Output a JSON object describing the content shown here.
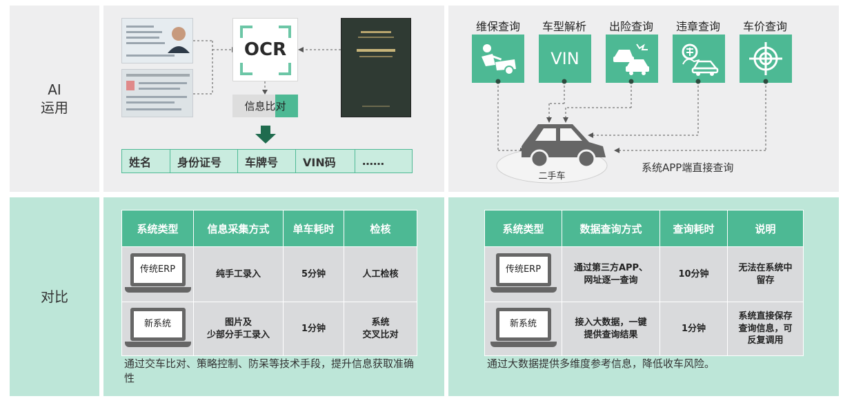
{
  "rows": {
    "ai": "AI\n运用",
    "compare": "对比"
  },
  "ocr": {
    "label": "OCR",
    "compare_label": "信息比对",
    "fields": [
      "姓名",
      "身份证号",
      "车牌号",
      "VIN码",
      "……"
    ]
  },
  "services": {
    "items": [
      {
        "label": "维保查询",
        "icon": "repair-icon"
      },
      {
        "label": "车型解析",
        "icon": "vin-icon",
        "tile_text": "VIN"
      },
      {
        "label": "出险查询",
        "icon": "accident-icon"
      },
      {
        "label": "违章查询",
        "icon": "violation-icon"
      },
      {
        "label": "车价查询",
        "icon": "target-icon"
      }
    ],
    "car_caption": "二手车",
    "direct_note": "系统APP端直接查询"
  },
  "left_table": {
    "headers": [
      "系统类型",
      "信息采集方式",
      "单车耗时",
      "检核"
    ],
    "rows": [
      {
        "system": "传统ERP",
        "method": "纯手工录入",
        "time": "5分钟",
        "check": "人工检核"
      },
      {
        "system": "新系统",
        "method": "图片及\n少部分手工录入",
        "time": "1分钟",
        "check": "系统\n交叉比对"
      }
    ],
    "footnote": "通过交车比对、策略控制、防呆等技术手段，提升信息获取准确性"
  },
  "right_table": {
    "headers": [
      "系统类型",
      "数据查询方式",
      "查询耗时",
      "说明"
    ],
    "rows": [
      {
        "system": "传统ERP",
        "method": "通过第三方APP、\n网址逐一查询",
        "time": "10分钟",
        "note": "无法在系统中\n留存"
      },
      {
        "system": "新系统",
        "method": "接入大数据，一键\n提供查询结果",
        "time": "1分钟",
        "note": "系统直接保存\n查询信息，可\n反复调用"
      }
    ],
    "footnote": "通过大数据提供多维度参考信息，降低收车风险。"
  },
  "colors": {
    "accent": "#4db994",
    "panel_gray": "#eeeeef",
    "panel_green": "#bde6d8"
  }
}
